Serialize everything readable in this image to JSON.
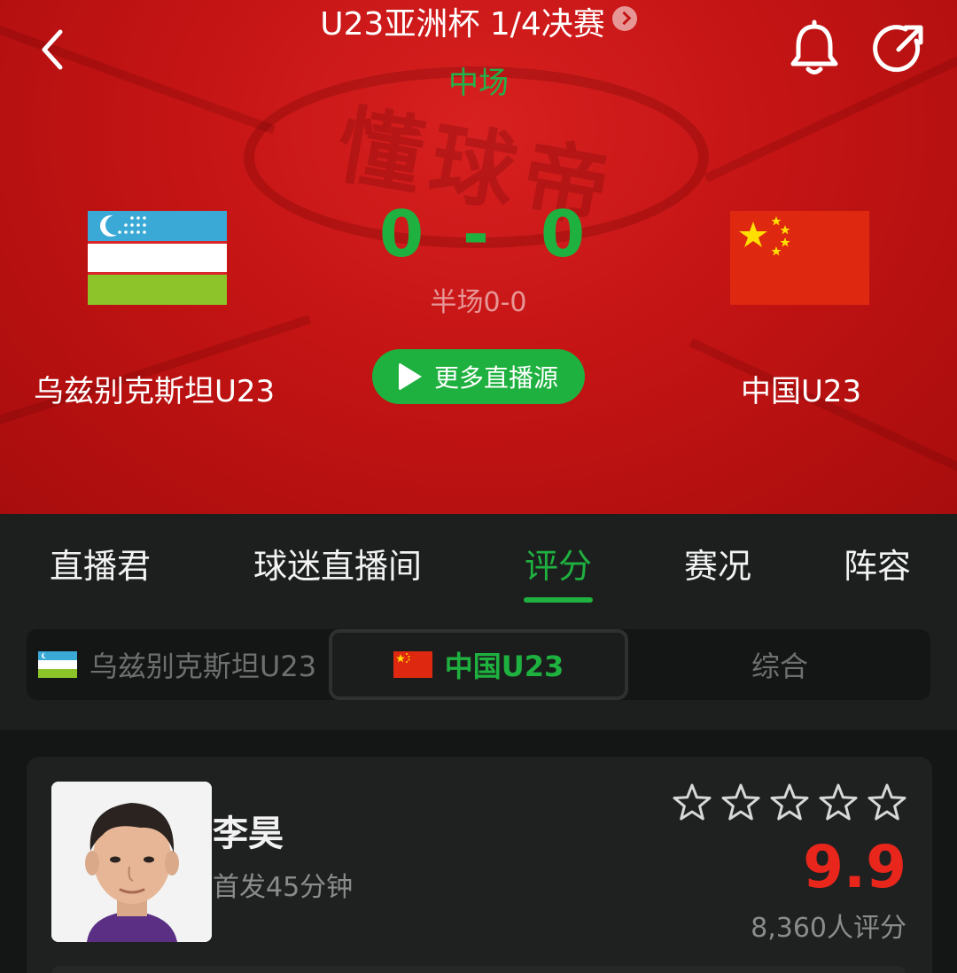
{
  "header": {
    "competition_title": "U23亚洲杯 1/4决赛",
    "match_status": "中场",
    "home_team": "乌兹别克斯坦U23",
    "away_team": "中国U23",
    "home_score": "0",
    "score_separator": "-",
    "away_score": "0",
    "halftime": "半场0-0",
    "live_button_label": "更多直播源",
    "watermark": "懂球帝"
  },
  "tabs": [
    {
      "label": "直播君"
    },
    {
      "label": "球迷直播间"
    },
    {
      "label": "评分"
    },
    {
      "label": "赛况"
    },
    {
      "label": "阵容"
    }
  ],
  "active_tab": "评分",
  "team_switch": {
    "home": "乌兹别克斯坦U23",
    "away": "中国U23",
    "overall": "综合",
    "selected": "中国U23"
  },
  "player": {
    "name": "李昊",
    "meta": "首发45分钟",
    "rating": "9.9",
    "raters": "8,360人评分",
    "stars_filled": 0,
    "stars_total": 5
  },
  "colors": {
    "accent_green": "#1fb13f",
    "banner_red": "#c41414",
    "rating_red": "#e8261c"
  },
  "icons": [
    "back-icon",
    "info-chevron-icon",
    "bell-icon",
    "share-icon",
    "play-icon",
    "star-outline-icon"
  ]
}
